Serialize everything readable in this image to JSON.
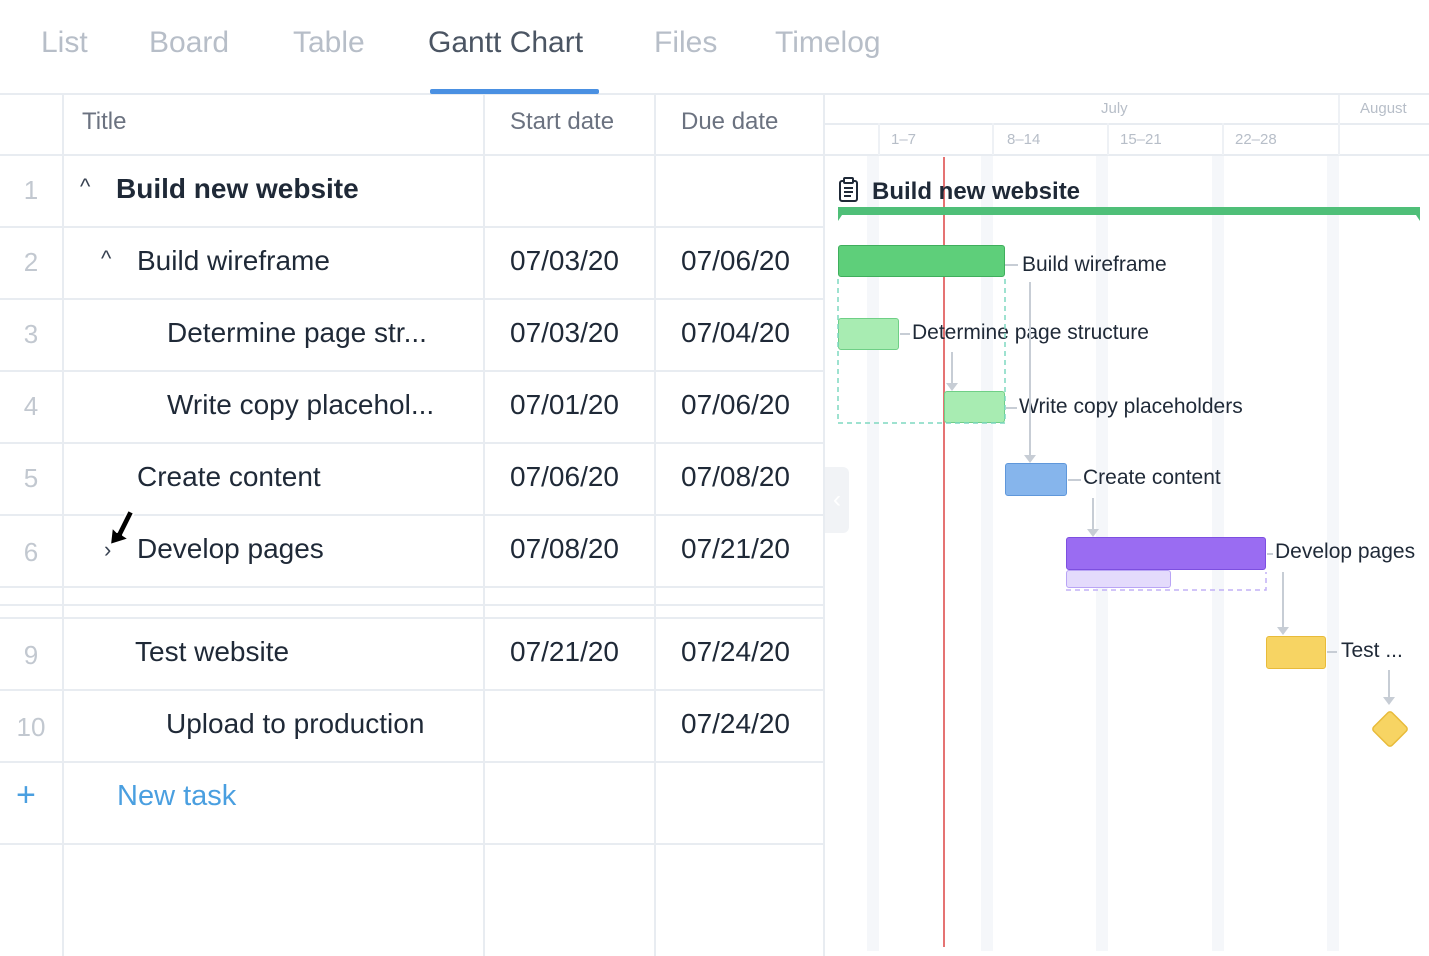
{
  "tabs": [
    {
      "label": "List"
    },
    {
      "label": "Board"
    },
    {
      "label": "Table"
    },
    {
      "label": "Gantt Chart"
    },
    {
      "label": "Files"
    },
    {
      "label": "Timelog"
    }
  ],
  "active_tab": "Gantt Chart",
  "table": {
    "headers": {
      "title": "Title",
      "start_date": "Start date",
      "due_date": "Due date"
    },
    "rows": [
      {
        "num": "1",
        "title": "Build new website",
        "start": "",
        "due": ""
      },
      {
        "num": "2",
        "title": "Build wireframe",
        "start": "07/03/20",
        "due": "07/06/20"
      },
      {
        "num": "3",
        "title": "Determine page str...",
        "start": "07/03/20",
        "due": "07/04/20"
      },
      {
        "num": "4",
        "title": "Write copy placehol...",
        "start": "07/01/20",
        "due": "07/06/20"
      },
      {
        "num": "5",
        "title": "Create content",
        "start": "07/06/20",
        "due": "07/08/20"
      },
      {
        "num": "6",
        "title": "Develop pages",
        "start": "07/08/20",
        "due": "07/21/20"
      },
      {
        "num": "9",
        "title": "Test website",
        "start": "07/21/20",
        "due": "07/24/20"
      },
      {
        "num": "10",
        "title": "Upload to production",
        "start": "",
        "due": "07/24/20"
      }
    ],
    "new_task_label": "New task"
  },
  "gantt": {
    "months": [
      "July",
      "August"
    ],
    "weeks": [
      "1–7",
      "8–14",
      "15–21",
      "22–28"
    ],
    "project_label": "Build new website",
    "bars": [
      {
        "label": "Build wireframe",
        "color": "#5ecf7a"
      },
      {
        "label": "Determine page structure",
        "color": "#a8ecb2"
      },
      {
        "label": "Write copy placeholders",
        "color": "#a8ecb2"
      },
      {
        "label": "Create content",
        "color": "#86b5ec"
      },
      {
        "label": "Develop pages",
        "color": "#9a6cf2"
      },
      {
        "label": "Test ...",
        "color": "#f7d463"
      }
    ],
    "project_bar_color": "#4fbf78",
    "milestone_color": "#f7d463",
    "today_line_color": "#e57373"
  }
}
